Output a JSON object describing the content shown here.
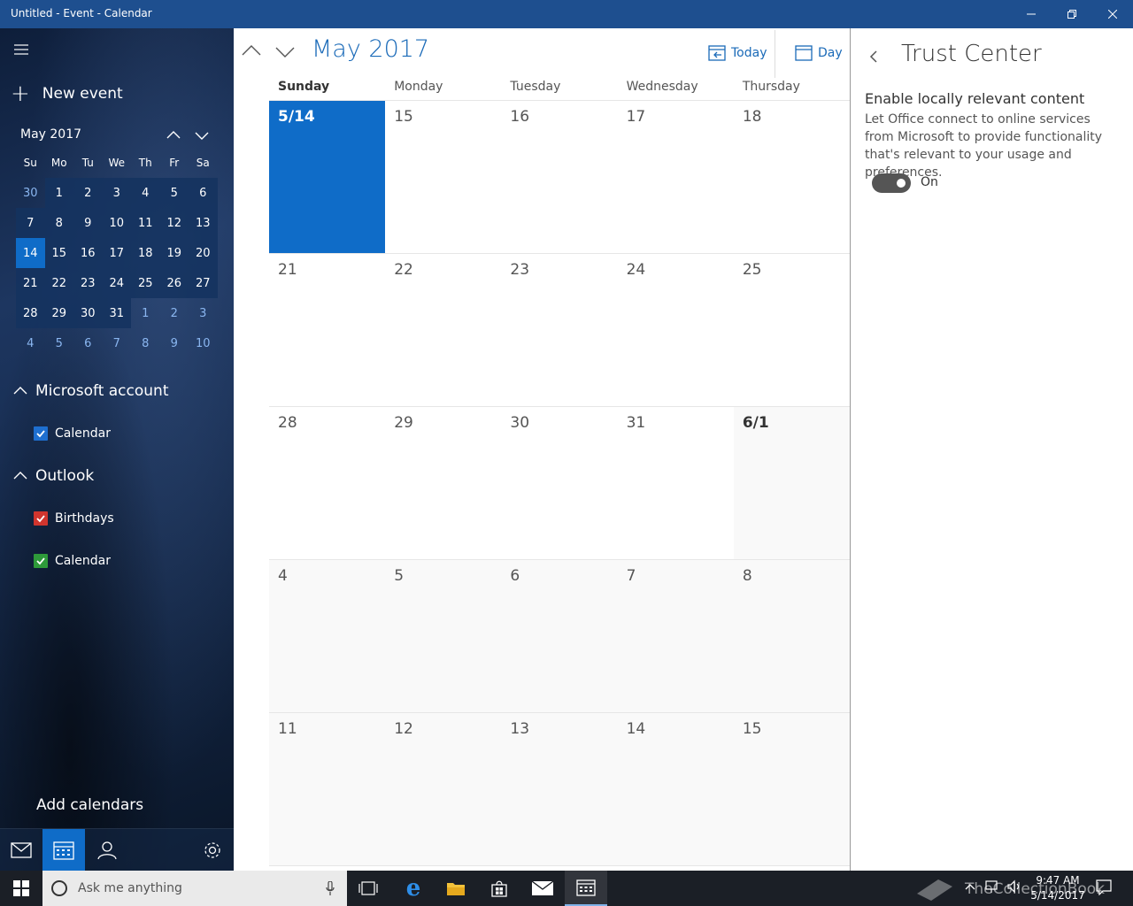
{
  "window": {
    "title": "Untitled - Event - Calendar"
  },
  "sidebar": {
    "new_event": "New event",
    "mini": {
      "month": "May 2017",
      "dow": [
        "Su",
        "Mo",
        "Tu",
        "We",
        "Th",
        "Fr",
        "Sa"
      ],
      "weeks": [
        [
          "30",
          "1",
          "2",
          "3",
          "4",
          "5",
          "6"
        ],
        [
          "7",
          "8",
          "9",
          "10",
          "11",
          "12",
          "13"
        ],
        [
          "14",
          "15",
          "16",
          "17",
          "18",
          "19",
          "20"
        ],
        [
          "21",
          "22",
          "23",
          "24",
          "25",
          "26",
          "27"
        ],
        [
          "28",
          "29",
          "30",
          "31",
          "1",
          "2",
          "3"
        ],
        [
          "4",
          "5",
          "6",
          "7",
          "8",
          "9",
          "10"
        ]
      ]
    },
    "accounts": [
      {
        "name": "Microsoft account",
        "calendars": [
          {
            "name": "Calendar",
            "color": "#1e6fd0"
          }
        ]
      },
      {
        "name": "Outlook",
        "calendars": [
          {
            "name": "Birthdays",
            "color": "#d0352e"
          },
          {
            "name": "Calendar",
            "color": "#2e9a3a"
          }
        ]
      }
    ],
    "add_calendars": "Add calendars"
  },
  "main": {
    "month_title": "May 2017",
    "today_label": "Today",
    "day_label": "Day",
    "dow": [
      "Sunday",
      "Monday",
      "Tuesday",
      "Wednesday",
      "Thursday"
    ],
    "weeks": [
      [
        "5/14",
        "15",
        "16",
        "17",
        "18"
      ],
      [
        "21",
        "22",
        "23",
        "24",
        "25"
      ],
      [
        "28",
        "29",
        "30",
        "31",
        "6/1"
      ],
      [
        "4",
        "5",
        "6",
        "7",
        "8"
      ],
      [
        "11",
        "12",
        "13",
        "14",
        "15"
      ]
    ]
  },
  "panel": {
    "title": "Trust Center",
    "setting_title": "Enable locally relevant content",
    "setting_desc": "Let Office connect to online services from Microsoft to provide functionality that's relevant to your usage and preferences.",
    "toggle_label": "On"
  },
  "taskbar": {
    "search_placeholder": "Ask me anything",
    "time": "9:47 AM",
    "date": "5/14/2017",
    "watermark": "TheCollectionBook"
  },
  "colors": {
    "accent": "#0f6cc8",
    "titlebar": "#1e4f8f"
  }
}
